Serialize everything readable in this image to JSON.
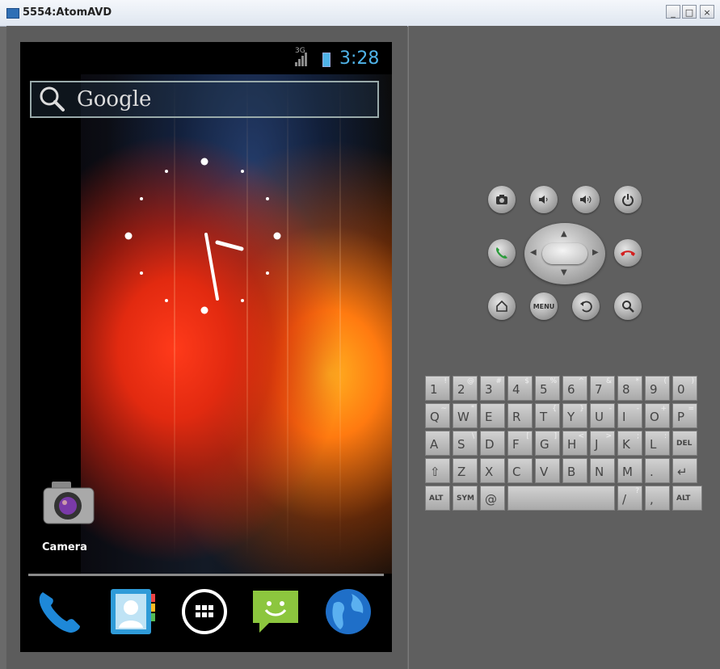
{
  "window": {
    "title": "5554:AtomAVD",
    "btn_min": "_",
    "btn_max": "□",
    "btn_close": "×"
  },
  "status": {
    "time": "3:28",
    "network": "3G"
  },
  "search": {
    "label": "Google"
  },
  "desktop": {
    "camera_label": "Camera"
  },
  "dock": [
    "phone-icon",
    "contacts-icon",
    "all-apps-icon",
    "messaging-icon",
    "browser-icon"
  ],
  "controls": {
    "row1": [
      "camera-icon",
      "volume-down-icon",
      "volume-up-icon",
      "power-icon"
    ],
    "row3_menu": "MENU"
  },
  "keyboard": {
    "row1": [
      [
        "1",
        "!"
      ],
      [
        "2",
        "@"
      ],
      [
        "3",
        "#"
      ],
      [
        "4",
        "$"
      ],
      [
        "5",
        "%"
      ],
      [
        "6",
        "^"
      ],
      [
        "7",
        "&"
      ],
      [
        "8",
        "*"
      ],
      [
        "9",
        "("
      ],
      [
        "0",
        ")"
      ]
    ],
    "row2": [
      [
        "Q",
        "~"
      ],
      [
        "W",
        "\""
      ],
      [
        "E",
        ""
      ],
      [
        "R",
        ""
      ],
      [
        "T",
        "{"
      ],
      [
        "Y",
        "}"
      ],
      [
        "U",
        "-"
      ],
      [
        "I",
        "-"
      ],
      [
        "O",
        "+"
      ],
      [
        "P",
        "="
      ]
    ],
    "row3": [
      [
        "A",
        ""
      ],
      [
        "S",
        "\\"
      ],
      [
        "D",
        ""
      ],
      [
        "F",
        "["
      ],
      [
        "G",
        "]"
      ],
      [
        "H",
        "<"
      ],
      [
        "J",
        ">"
      ],
      [
        "K",
        ";"
      ],
      [
        "L",
        ":"
      ],
      [
        "DEL",
        ""
      ]
    ],
    "row4": [
      [
        "⇧",
        ""
      ],
      [
        "Z",
        ""
      ],
      [
        "X",
        ""
      ],
      [
        "C",
        ""
      ],
      [
        "V",
        ""
      ],
      [
        "B",
        ""
      ],
      [
        "N",
        ""
      ],
      [
        "M",
        ""
      ],
      [
        ".",
        ""
      ],
      [
        "↵",
        ""
      ]
    ],
    "row5": {
      "alt_left": "ALT",
      "sym": "SYM",
      "at": "@",
      "slash": "/",
      "question": "?",
      "comma": ",",
      "alt_right": "ALT"
    }
  },
  "colors": {
    "accent": "#4fb3e8",
    "call_green": "#2c9c3c",
    "hangup_red": "#d32020"
  }
}
